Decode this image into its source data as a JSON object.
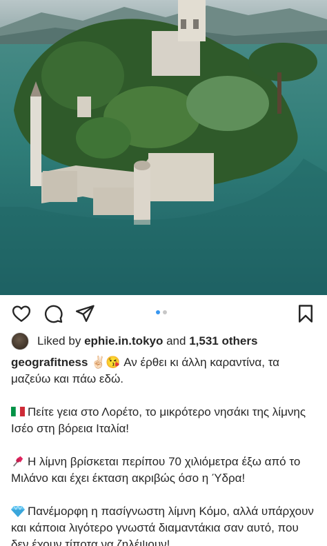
{
  "post": {
    "photo_alt": "Aerial photo of an island castle on a lake",
    "carousel": {
      "pages": 2,
      "current": 1
    }
  },
  "actions": {
    "like_icon": "heart-icon",
    "comment_icon": "comment-icon",
    "share_icon": "send-icon",
    "save_icon": "bookmark-icon"
  },
  "likes": {
    "prefix": "Liked by",
    "user": "ephie.in.tokyo",
    "and": "and",
    "count": "1,531 others"
  },
  "caption": {
    "username": "geografitness",
    "line1": "✌🏻😘 Αν έρθει κι άλλη καραντίνα, τα μαζεύω και πάω εδώ.",
    "line2": "Πείτε γεια στο Λορέτο, το μικρότερο νησάκι της λίμνης Ισέο στη βόρεια Ιταλία!",
    "line3": "Η λίμνη βρίσκεται περίπου 70 χιλιόμετρα έξω από το Μιλάνο και έχει έκταση ακριβώς όσο η Ύδρα!",
    "line4": "Πανέμορφη η πασίγνωστη λίμνη Κόμο, αλλά υπάρχουν και κάποια λιγότερο γνωστά διαμαντάκια σαν αυτό, που δεν έχουν τίποτα να ζηλέψουν!",
    "icons": [
      "italy-flag-icon",
      "pushpin-icon",
      "diamond-icon"
    ]
  },
  "colors": {
    "text": "#262626",
    "active_dot": "#3897f0",
    "inactive_dot": "#c7c7c7"
  }
}
